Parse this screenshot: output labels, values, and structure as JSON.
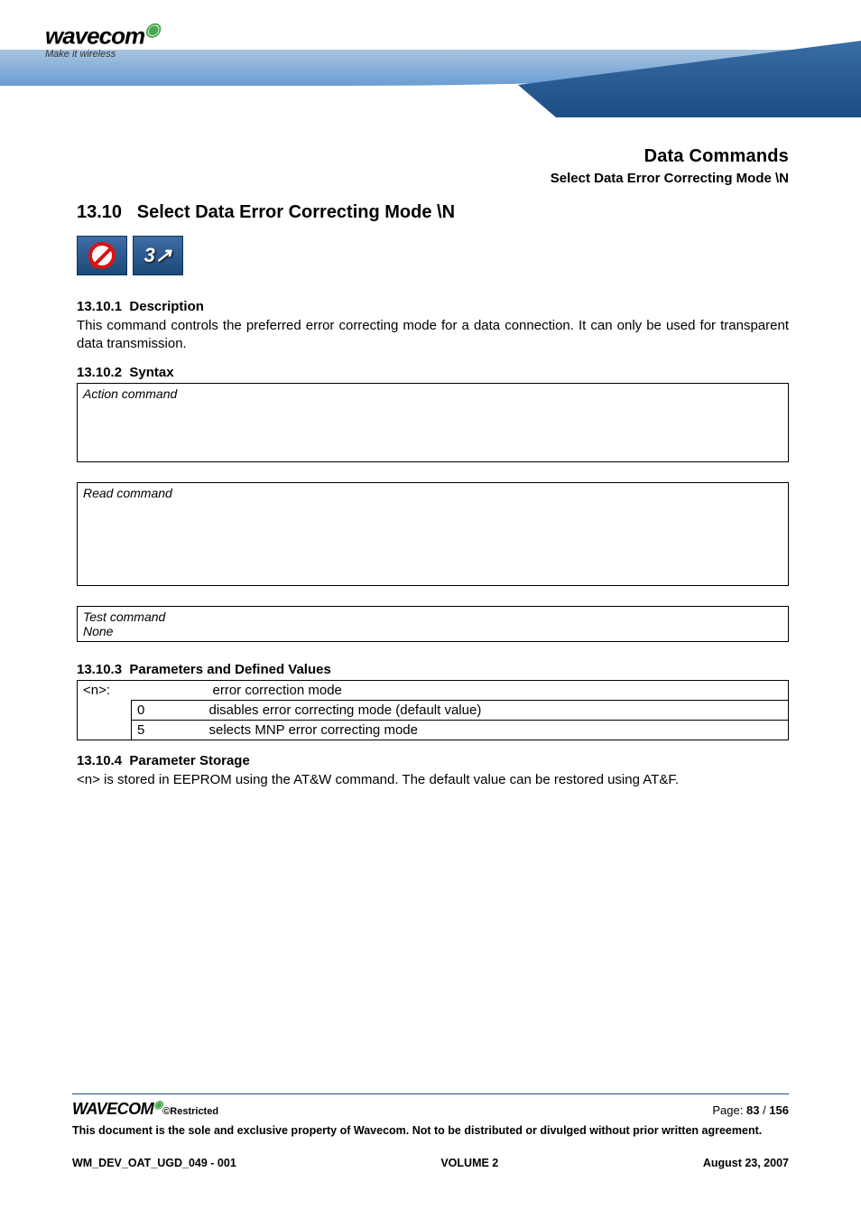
{
  "header": {
    "logo_text": "wavecom",
    "tagline": "Make it wireless",
    "chapter": "Data Commands",
    "subchapter": "Select Data Error Correcting Mode \\N"
  },
  "section": {
    "number": "13.10",
    "title": "Select Data Error Correcting Mode \\N",
    "icons": {
      "forbid_name": "not-allowed-icon",
      "threeg_label": "3"
    }
  },
  "sub1": {
    "heading_num": "13.10.1",
    "heading": "Description",
    "body": "This command controls the preferred error correcting mode for a data connection. It can only be used for transparent data transmission."
  },
  "sub2": {
    "heading_num": "13.10.2",
    "heading": "Syntax",
    "action_label": "Action command",
    "read_label": "Read command",
    "test_label": "Test command",
    "test_body": "None"
  },
  "sub3": {
    "heading_num": "13.10.3",
    "heading": "Parameters and Defined Values",
    "param_name": "<n>:",
    "param_desc": "error correction mode",
    "rows": [
      {
        "value": "0",
        "desc": "disables error correcting mode (default value)"
      },
      {
        "value": "5",
        "desc": "selects MNP error correcting mode"
      }
    ]
  },
  "sub4": {
    "heading_num": "13.10.4",
    "heading": "Parameter Storage",
    "body": "<n> is stored in EEPROM using the AT&W command. The default value can be restored using AT&F."
  },
  "footer": {
    "logo": "WAVECOM",
    "restricted": "©Restricted",
    "page_label": "Page: ",
    "page_current": "83",
    "page_sep": " / ",
    "page_total": "156",
    "legal": "This document is the sole and exclusive property of Wavecom. Not to be distributed or divulged without prior written agreement.",
    "doc_id": "WM_DEV_OAT_UGD_049 - 001",
    "volume": "VOLUME 2",
    "date": "August 23, 2007"
  }
}
